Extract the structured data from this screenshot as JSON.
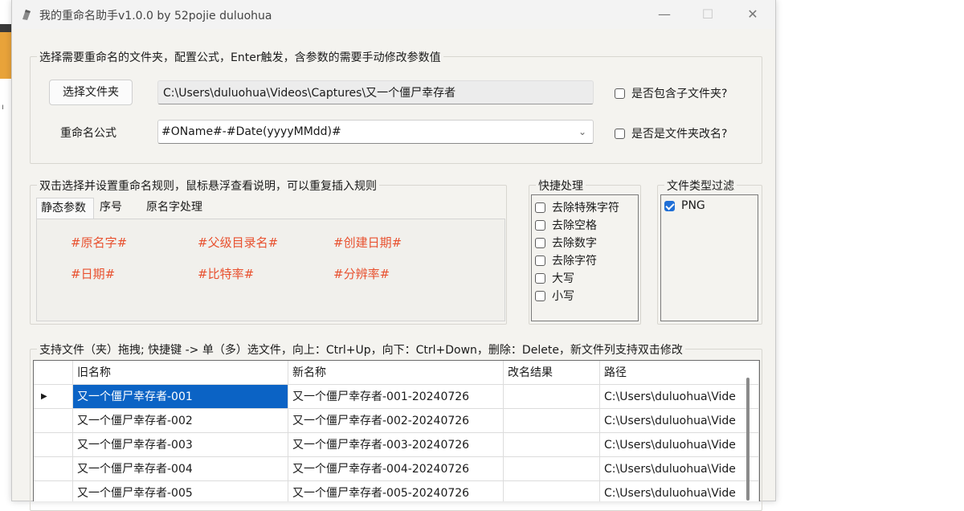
{
  "window": {
    "title": "我的重命名助手v1.0.0 by 52pojie duluohua",
    "min_glyph": "—",
    "max_glyph": "☐",
    "close_glyph": "✕"
  },
  "folder_group": {
    "legend": "选择需要重命名的文件夹，配置公式，Enter触发，含参数的需要手动修改参数值",
    "select_folder_label": "选择文件夹",
    "folder_path": "C:\\Users\\duluohua\\Videos\\Captures\\又一个僵尸幸存者",
    "include_subfolders_label": "是否包含子文件夹?",
    "include_subfolders_checked": false,
    "formula_label": "重命名公式",
    "formula_value": "#OName#-#Date(yyyyMMdd)#",
    "rename_folders_label": "是否是文件夹改名?",
    "rename_folders_checked": false
  },
  "rules_group": {
    "legend": "双击选择并设置重命名规则，鼠标悬浮查看说明，可以重复插入规则",
    "tabs": [
      "静态参数",
      "序号",
      "原名字处理"
    ],
    "active_tab": 0,
    "params": [
      "#原名字#",
      "#父级目录名#",
      "#创建日期#",
      "#日期#",
      "#比特率#",
      "#分辨率#"
    ]
  },
  "quick_group": {
    "legend": "快捷处理",
    "options": [
      {
        "label": "去除特殊字符",
        "checked": false
      },
      {
        "label": "去除空格",
        "checked": false
      },
      {
        "label": "去除数字",
        "checked": false
      },
      {
        "label": "去除字符",
        "checked": false
      },
      {
        "label": "大写",
        "checked": false
      },
      {
        "label": "小写",
        "checked": false
      }
    ]
  },
  "filter_group": {
    "legend": "文件类型过滤",
    "options": [
      {
        "label": "PNG",
        "checked": true
      }
    ]
  },
  "files_group": {
    "legend": "支持文件（夹）拖拽; 快捷键 -> 单（多）选文件，向上：Ctrl+Up，向下：Ctrl+Down，删除：Delete，新文件列支持双击修改",
    "columns": [
      "",
      "旧名称",
      "新名称",
      "改名结果",
      "路径"
    ],
    "current_row_marker": "▶",
    "rows": [
      {
        "old": "又一个僵尸幸存者-001",
        "new": "又一个僵尸幸存者-001-20240726",
        "result": "",
        "path": "C:\\Users\\duluohua\\Vide"
      },
      {
        "old": "又一个僵尸幸存者-002",
        "new": "又一个僵尸幸存者-002-20240726",
        "result": "",
        "path": "C:\\Users\\duluohua\\Vide"
      },
      {
        "old": "又一个僵尸幸存者-003",
        "new": "又一个僵尸幸存者-003-20240726",
        "result": "",
        "path": "C:\\Users\\duluohua\\Vide"
      },
      {
        "old": "又一个僵尸幸存者-004",
        "new": "又一个僵尸幸存者-004-20240726",
        "result": "",
        "path": "C:\\Users\\duluohua\\Vide"
      },
      {
        "old": "又一个僵尸幸存者-005",
        "new": "又一个僵尸幸存者-005-20240726",
        "result": "",
        "path": "C:\\Users\\duluohua\\Vide"
      }
    ],
    "selected_row": 0
  },
  "colors": {
    "param_text": "#e8512f",
    "selection": "#0b63c5",
    "checkbox_checked": "#1f6fd6"
  }
}
